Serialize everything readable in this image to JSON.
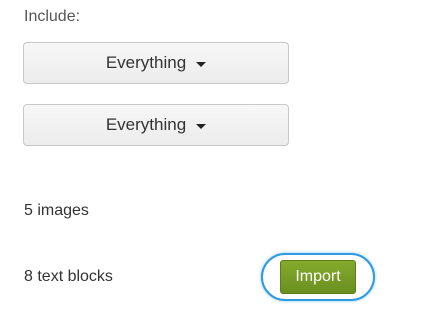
{
  "include": {
    "label": "Include:"
  },
  "dropdowns": [
    {
      "selected": "Everything",
      "icon": "caret-down-icon"
    },
    {
      "selected": "Everything",
      "icon": "caret-down-icon"
    }
  ],
  "stats": {
    "images": "5 images",
    "text_blocks": "8 text blocks"
  },
  "actions": {
    "import_label": "Import",
    "import_color": "#76a024",
    "highlight_color": "#2f9ae0"
  }
}
